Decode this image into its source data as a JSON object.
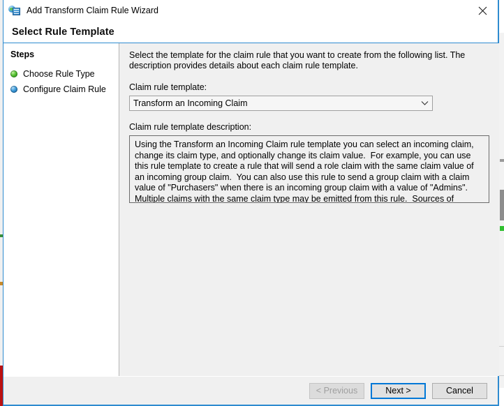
{
  "window": {
    "title": "Add Transform Claim Rule Wizard",
    "icon": "adfs-claim-rule-icon",
    "close_label": "×",
    "accent_color": "#2e8bd0"
  },
  "page": {
    "title": "Select Rule Template"
  },
  "sidebar": {
    "heading": "Steps",
    "items": [
      {
        "label": "Choose Rule Type",
        "bullet": "green",
        "icon": "step-complete-icon"
      },
      {
        "label": "Configure Claim Rule",
        "bullet": "blue",
        "icon": "step-current-icon"
      }
    ]
  },
  "content": {
    "intro": "Select the template for the claim rule that you want to create from the following list. The description provides details about each claim rule template.",
    "template_label": "Claim rule template:",
    "template_value": "Transform an Incoming Claim",
    "template_options": [
      "Transform an Incoming Claim"
    ],
    "dropdown_icon": "chevron-down-icon",
    "description_label": "Claim rule template description:",
    "description_text": "Using the Transform an Incoming Claim rule template you can select an incoming claim, change its claim type, and optionally change its claim value.  For example, you can use this rule template to create a rule that will send a role claim with the same claim value of an incoming group claim.  You can also use this rule to send a group claim with a claim value of \"Purchasers\" when there is an incoming group claim with a value of \"Admins\".  Multiple claims with the same claim type may be emitted from this rule.  Sources of incoming claims vary based on the rules being edited."
  },
  "footer": {
    "previous_label": "< Previous",
    "previous_enabled": false,
    "next_label": "Next >",
    "next_is_default": true,
    "cancel_label": "Cancel"
  }
}
